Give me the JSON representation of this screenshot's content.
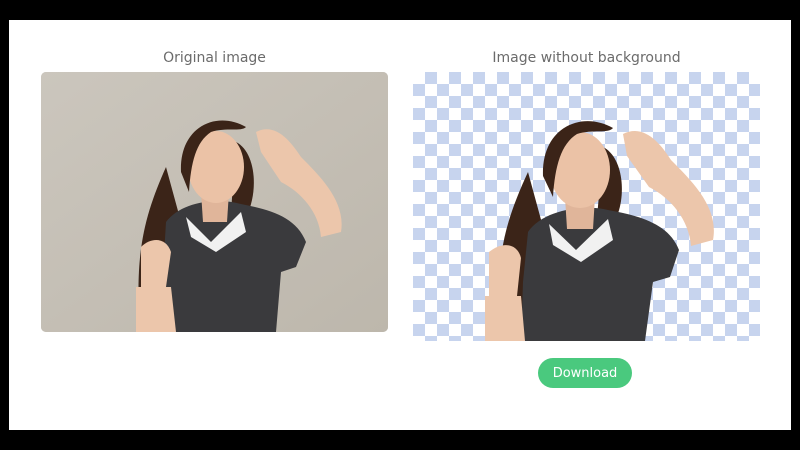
{
  "left_panel": {
    "caption": "Original image"
  },
  "right_panel": {
    "caption": "Image without background"
  },
  "download_button": {
    "label": "Download"
  },
  "colors": {
    "accent": "#4ac97e",
    "original_bg": "#c9c4bb",
    "checker": "#c7d4ee",
    "caption_text": "#6b6b6b"
  }
}
